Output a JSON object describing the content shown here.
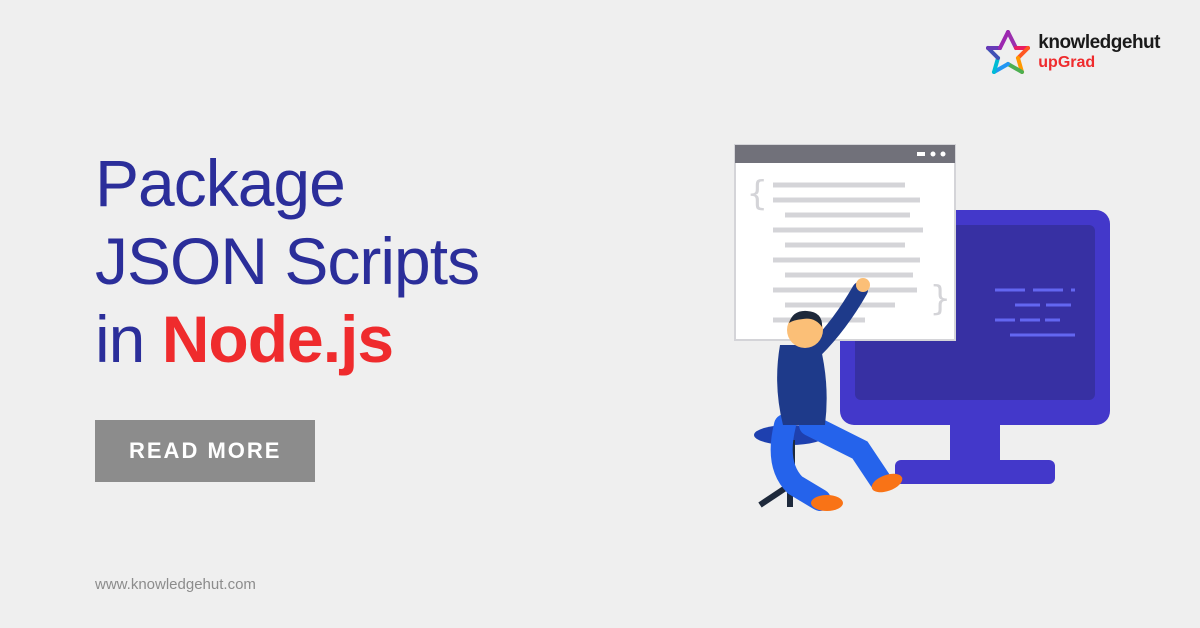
{
  "logo": {
    "main": "knowledgehut",
    "sub": "upGrad"
  },
  "heading": {
    "line1": "Package",
    "line2": "JSON Scripts",
    "line3_prefix": "in ",
    "line3_highlight": "Node.js"
  },
  "cta": {
    "label": "READ MORE"
  },
  "footer": {
    "url": "www.knowledgehut.com"
  }
}
